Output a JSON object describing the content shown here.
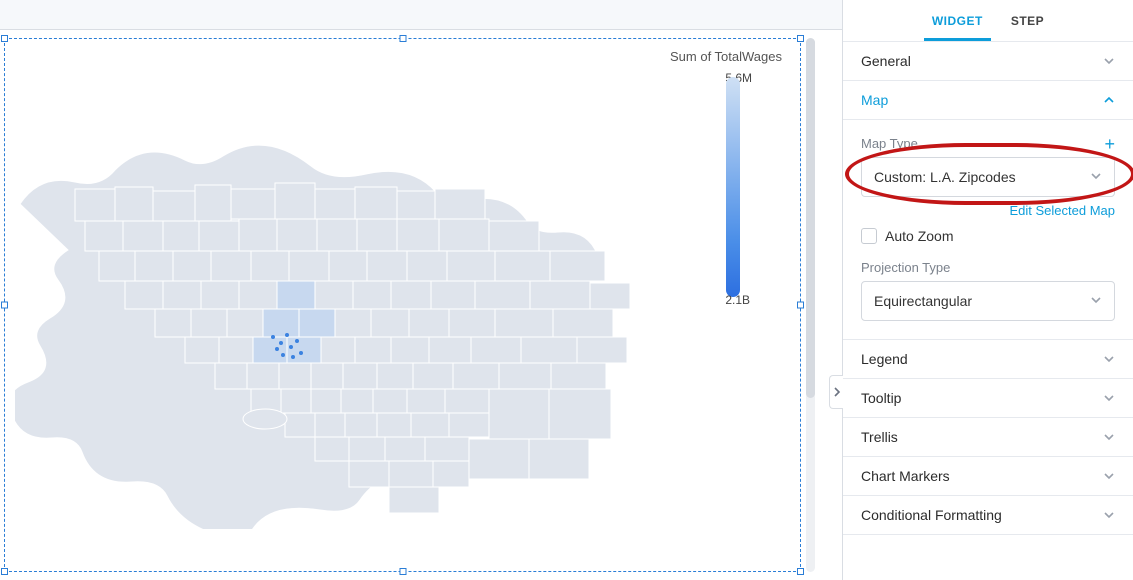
{
  "tabs": {
    "widget": "WIDGET",
    "step": "STEP"
  },
  "chart": {
    "title": "Sum of TotalWages",
    "legend_max": "5.6M",
    "legend_min": "2.1B"
  },
  "sections": {
    "general": "General",
    "map": "Map",
    "legend": "Legend",
    "tooltip": "Tooltip",
    "trellis": "Trellis",
    "chart_markers": "Chart Markers",
    "cond_fmt": "Conditional Formatting"
  },
  "map": {
    "type_label": "Map Type",
    "type_value": "Custom: L.A. Zipcodes",
    "edit_link": "Edit Selected Map",
    "auto_zoom": "Auto Zoom",
    "proj_label": "Projection Type",
    "proj_value": "Equirectangular"
  }
}
